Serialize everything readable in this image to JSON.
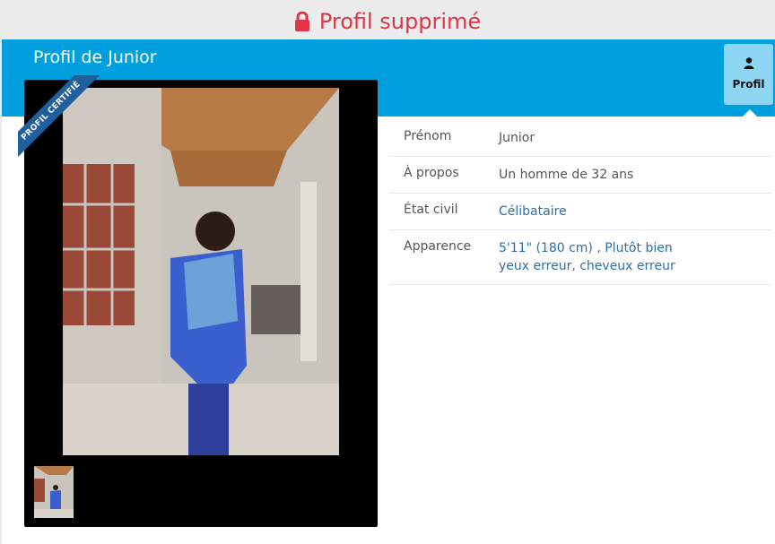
{
  "banner": {
    "status_text": "Profil supprimé",
    "icon": "lock-icon",
    "color": "#e03548"
  },
  "profile": {
    "title": "Profil de Junior",
    "certified_label": "PROFIL CERTIFIÉ",
    "tab": {
      "label": "Profil",
      "icon": "user-icon"
    }
  },
  "details": [
    {
      "key": "Prénom",
      "value": "Junior",
      "link": false
    },
    {
      "key": "À propos",
      "value": "Un homme de 32 ans",
      "link": false
    },
    {
      "key": "État civil",
      "value": "Célibataire",
      "link": true
    },
    {
      "key": "Apparence",
      "value": "5'11\" (180 cm) , Plutôt bien",
      "value2": "yeux erreur, cheveux erreur",
      "link": true
    }
  ],
  "colors": {
    "header_blue": "#009fde",
    "tab_active": "#8fd6f4",
    "link": "#2f6fa5",
    "ribbon": "#1f5f9e"
  }
}
